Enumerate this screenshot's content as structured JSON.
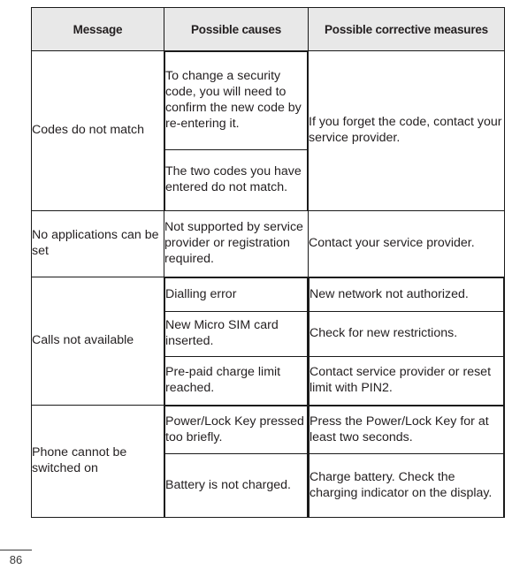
{
  "page": {
    "number": "86"
  },
  "table": {
    "columns": [
      {
        "key": "message",
        "label": "Message"
      },
      {
        "key": "causes",
        "label": "Possible causes"
      },
      {
        "key": "measures",
        "label": "Possible corrective measures"
      }
    ],
    "rows": [
      {
        "message": "Codes do not match",
        "causes": [
          "To change a security code, you will need to confirm the new code by re-entering it.",
          "The two codes you have entered do not match."
        ],
        "measures": [
          "If you forget the code, contact your service provider."
        ],
        "measures_span": "all"
      },
      {
        "message": "No applications can be set",
        "causes": [
          "Not supported by service provider or registration required."
        ],
        "measures": [
          "Contact your service provider."
        ],
        "measures_span": "all"
      },
      {
        "message": "Calls not available",
        "causes": [
          "Dialling error",
          "New Micro SIM card inserted.",
          "Pre-paid charge limit reached."
        ],
        "measures": [
          "New network not authorized.",
          "Check for new restrictions.",
          "Contact service provider or reset limit with PIN2."
        ],
        "measures_span": "each"
      },
      {
        "message": "Phone cannot be switched on",
        "causes": [
          "Power/Lock Key pressed too briefly.",
          "Battery is not charged."
        ],
        "measures": [
          "Press the Power/Lock Key for at least two seconds.",
          "Charge battery. Check the charging indicator on the display."
        ],
        "measures_span": "each"
      }
    ]
  },
  "colors": {
    "header_background": "#e8e8e8",
    "border": "#1a1a1a",
    "text": "#231f20",
    "folio": "#3a3a3a"
  }
}
